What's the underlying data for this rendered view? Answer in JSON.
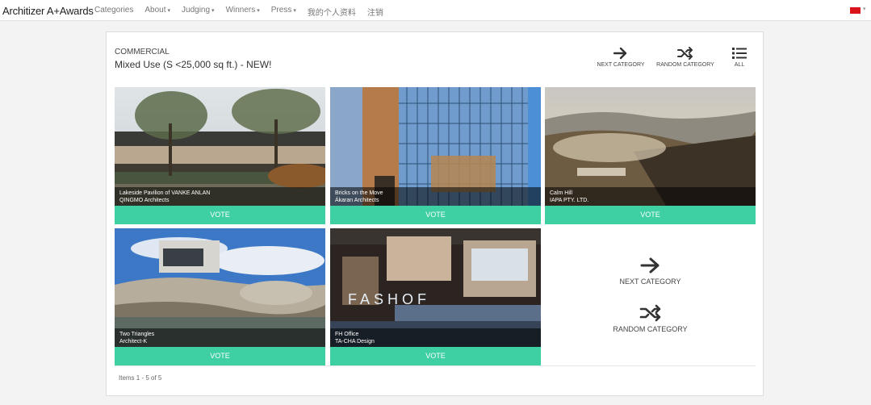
{
  "nav": {
    "brand": "Architizer A+Awards",
    "items": [
      {
        "label": "Categories",
        "caret": ""
      },
      {
        "label": "About",
        "caret": "▾"
      },
      {
        "label": "Judging",
        "caret": "▾"
      },
      {
        "label": "Winners",
        "caret": "▾"
      },
      {
        "label": "Press",
        "caret": "▾"
      },
      {
        "label": "我的个人资料",
        "caret": ""
      },
      {
        "label": "注销",
        "caret": ""
      }
    ],
    "language_flag_color": "#d9141b",
    "language_caret": "▾"
  },
  "category": {
    "group": "COMMERCIAL",
    "title": "Mixed Use (S <25,000 sq ft.) - NEW!"
  },
  "controls": {
    "next": {
      "label": "NEXT CATEGORY",
      "icon": "arrow-right-icon"
    },
    "random": {
      "label": "RANDOM CATEGORY",
      "icon": "shuffle-icon"
    },
    "all": {
      "label": "ALL",
      "icon": "list-icon"
    }
  },
  "entries": [
    {
      "project": "Lakeside Pavilion of VANKE ANLAN",
      "firm": "QINGMO Architects",
      "vote": "VOTE"
    },
    {
      "project": "Bricks on the Move",
      "firm": "Ákaran Architects",
      "vote": "VOTE"
    },
    {
      "project": "Calm Hill",
      "firm": "IAPA PTY. LTD.",
      "vote": "VOTE"
    },
    {
      "project": "Two Triangles",
      "firm": "Architect-K",
      "vote": "VOTE"
    },
    {
      "project": "FH Office",
      "firm": "TA-CHA Design",
      "vote": "VOTE",
      "sign_text": "FASHOF"
    }
  ],
  "end_actions": {
    "next": "NEXT CATEGORY",
    "random": "RANDOM CATEGORY"
  },
  "footer": {
    "items_count": "Items 1 - 5 of 5"
  },
  "colors": {
    "vote": "#3ecfa2",
    "accent_flag": "#d9141b"
  }
}
